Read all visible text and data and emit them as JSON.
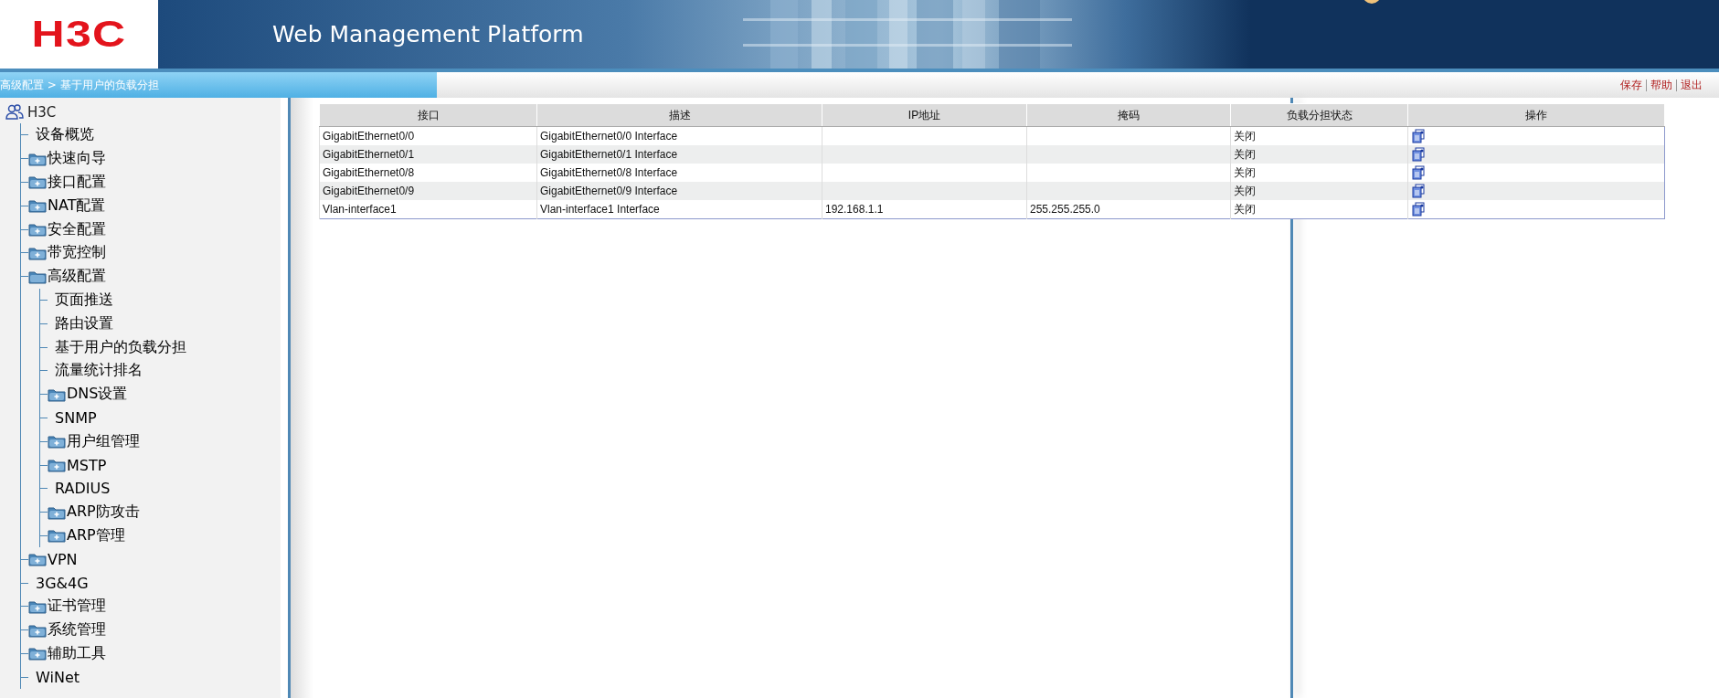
{
  "header": {
    "logo": "H3C",
    "title": "Web Management Platform"
  },
  "breadcrumb": "高级配置 > 基于用户的负载分担",
  "top_links": [
    "保存",
    "帮助",
    "退出"
  ],
  "tree": {
    "label": "H3C",
    "children": [
      {
        "label": "设备概览",
        "kind": "leaf"
      },
      {
        "label": "快速向导",
        "kind": "folder",
        "expanded": false
      },
      {
        "label": "接口配置",
        "kind": "folder",
        "expanded": false
      },
      {
        "label": "NAT配置",
        "kind": "folder",
        "expanded": false
      },
      {
        "label": "安全配置",
        "kind": "folder",
        "expanded": false
      },
      {
        "label": "带宽控制",
        "kind": "folder",
        "expanded": false
      },
      {
        "label": "高级配置",
        "kind": "folder",
        "expanded": true,
        "children": [
          {
            "label": "页面推送",
            "kind": "leaf"
          },
          {
            "label": "路由设置",
            "kind": "leaf"
          },
          {
            "label": "基于用户的负载分担",
            "kind": "leaf"
          },
          {
            "label": "流量统计排名",
            "kind": "leaf"
          },
          {
            "label": "DNS设置",
            "kind": "folder",
            "expanded": false
          },
          {
            "label": "SNMP",
            "kind": "leaf"
          },
          {
            "label": "用户组管理",
            "kind": "folder",
            "expanded": false
          },
          {
            "label": "MSTP",
            "kind": "folder",
            "expanded": false
          },
          {
            "label": "RADIUS",
            "kind": "leaf"
          },
          {
            "label": "ARP防攻击",
            "kind": "folder",
            "expanded": false
          },
          {
            "label": "ARP管理",
            "kind": "folder",
            "expanded": false
          }
        ]
      },
      {
        "label": "VPN",
        "kind": "folder",
        "expanded": false
      },
      {
        "label": "3G&4G",
        "kind": "leaf"
      },
      {
        "label": "证书管理",
        "kind": "folder",
        "expanded": false
      },
      {
        "label": "系统管理",
        "kind": "folder",
        "expanded": false
      },
      {
        "label": "辅助工具",
        "kind": "folder",
        "expanded": false
      },
      {
        "label": "WiNet",
        "kind": "leaf"
      }
    ]
  },
  "table": {
    "columns": [
      "接口",
      "描述",
      "IP地址",
      "掩码",
      "负载分担状态",
      "操作"
    ],
    "rows": [
      {
        "interface": "GigabitEthernet0/0",
        "description": "GigabitEthernet0/0 Interface",
        "ip": "",
        "mask": "",
        "status": "关闭"
      },
      {
        "interface": "GigabitEthernet0/1",
        "description": "GigabitEthernet0/1 Interface",
        "ip": "",
        "mask": "",
        "status": "关闭"
      },
      {
        "interface": "GigabitEthernet0/8",
        "description": "GigabitEthernet0/8 Interface",
        "ip": "",
        "mask": "",
        "status": "关闭"
      },
      {
        "interface": "GigabitEthernet0/9",
        "description": "GigabitEthernet0/9 Interface",
        "ip": "",
        "mask": "",
        "status": "关闭"
      },
      {
        "interface": "Vlan-interface1",
        "description": "Vlan-interface1 Interface",
        "ip": "192.168.1.1",
        "mask": "255.255.255.0",
        "status": "关闭"
      }
    ]
  }
}
